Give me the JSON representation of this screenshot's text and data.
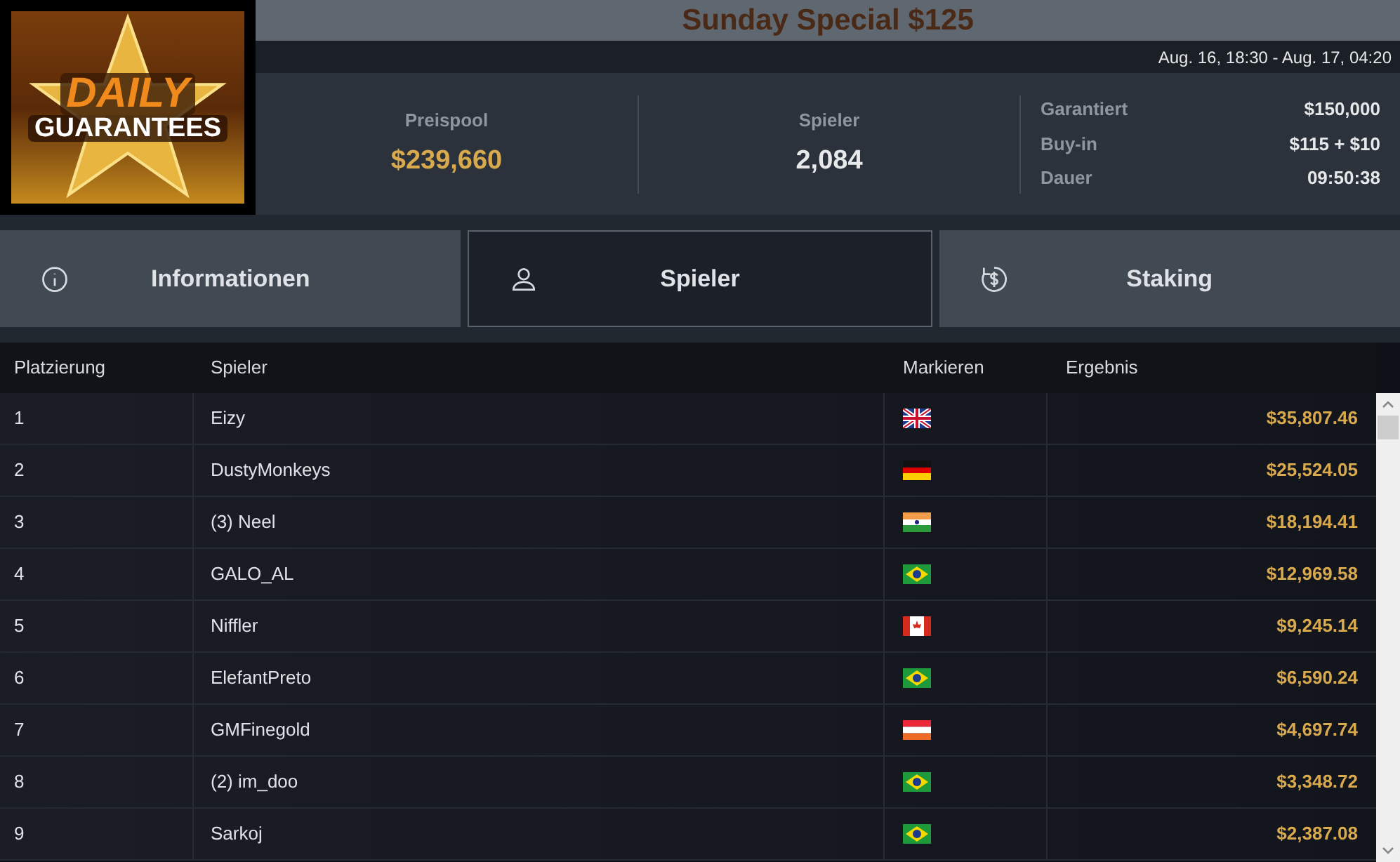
{
  "logo": {
    "line_1": "DAILY",
    "line_2": "GUARANTEES"
  },
  "title": "Sunday Special $125",
  "date_range": "Aug. 16, 18:30 - Aug. 17, 04:20",
  "stats": [
    {
      "label": "Preispool",
      "value": "$239,660",
      "highlight": true
    },
    {
      "label": "Spieler",
      "value": "2,084",
      "highlight": false
    }
  ],
  "details": [
    {
      "label": "Garantiert",
      "value": "$150,000"
    },
    {
      "label": "Buy-in",
      "value": "$115 + $10"
    },
    {
      "label": "Dauer",
      "value": "09:50:38"
    }
  ],
  "tabs": [
    {
      "label": "Informationen",
      "kind": "info",
      "selected": false
    },
    {
      "label": "Spieler",
      "kind": "user",
      "selected": true
    },
    {
      "label": "Staking",
      "kind": "staking",
      "selected": false
    }
  ],
  "table": {
    "columns": [
      "Platzierung",
      "Spieler",
      "Markieren",
      "Ergebnis"
    ],
    "rows": [
      {
        "place": "1",
        "player": "Eizy",
        "kind": "gb",
        "result": "$35,807.46"
      },
      {
        "place": "2",
        "player": "DustyMonkeys",
        "kind": "de",
        "result": "$25,524.05"
      },
      {
        "place": "3",
        "player": "(3) Neel",
        "kind": "in",
        "result": "$18,194.41"
      },
      {
        "place": "4",
        "player": "GALO_AL",
        "kind": "br",
        "result": "$12,969.58"
      },
      {
        "place": "5",
        "player": "Niffler",
        "kind": "ca",
        "result": "$9,245.14"
      },
      {
        "place": "6",
        "player": "ElefantPreto",
        "kind": "br",
        "result": "$6,590.24"
      },
      {
        "place": "7",
        "player": "GMFinegold",
        "kind": "at",
        "result": "$4,697.74"
      },
      {
        "place": "8",
        "player": "(2) im_doo",
        "kind": "br",
        "result": "$3,348.72"
      },
      {
        "place": "9",
        "player": "Sarkoj",
        "kind": "br",
        "result": "$2,387.08"
      }
    ]
  }
}
